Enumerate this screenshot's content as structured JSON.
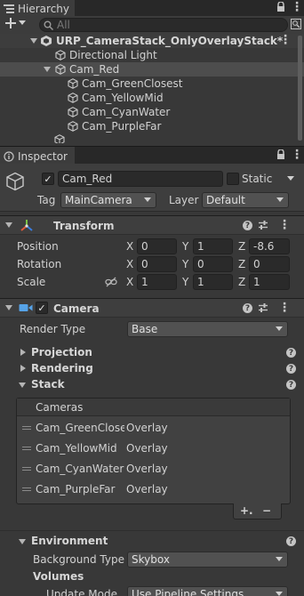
{
  "hierarchy": {
    "tab_label": "Hierarchy",
    "search_placeholder": "All",
    "scene_name": "URP_CameraStack_OnlyOverlayStack*",
    "items": [
      {
        "label": "Directional Light"
      },
      {
        "label": "Cam_Red"
      },
      {
        "label": "Cam_GreenClosest"
      },
      {
        "label": "Cam_YellowMid"
      },
      {
        "label": "Cam_CyanWater"
      },
      {
        "label": "Cam_PurpleFar"
      }
    ]
  },
  "inspector": {
    "tab_label": "Inspector",
    "object_name": "Cam_Red",
    "static_label": "Static",
    "tag_label": "Tag",
    "tag_value": "MainCamera",
    "layer_label": "Layer",
    "layer_value": "Default",
    "transform": {
      "title": "Transform",
      "rows": [
        {
          "label": "Position",
          "x": "0",
          "y": "1",
          "z": "-8.6"
        },
        {
          "label": "Rotation",
          "x": "0",
          "y": "0",
          "z": "0"
        },
        {
          "label": "Scale",
          "x": "1",
          "y": "1",
          "z": "1"
        }
      ],
      "axis_x": "X",
      "axis_y": "Y",
      "axis_z": "Z"
    },
    "camera": {
      "title": "Camera",
      "render_type_label": "Render Type",
      "render_type_value": "Base",
      "sections": {
        "projection": "Projection",
        "rendering": "Rendering",
        "stack": "Stack",
        "environment": "Environment"
      },
      "stack_list": {
        "header": "Cameras",
        "items": [
          {
            "name": "Cam_GreenClosest",
            "type": "Overlay"
          },
          {
            "name": "Cam_YellowMid",
            "type": "Overlay"
          },
          {
            "name": "Cam_CyanWater",
            "type": "Overlay"
          },
          {
            "name": "Cam_PurpleFar",
            "type": "Overlay"
          }
        ],
        "add_label": "+.",
        "remove_label": "−"
      },
      "environment": {
        "background_type_label": "Background Type",
        "background_type_value": "Skybox",
        "volumes_label": "Volumes",
        "update_mode_label": "Update Mode",
        "update_mode_value": "Use Pipeline Settings"
      }
    }
  },
  "colors": {
    "panel_bg": "#383838",
    "header_bg": "#3e3e3e",
    "tabbar_bg": "#282828",
    "field_bg": "#2a2a2a",
    "selected_row": "#4d4d4d",
    "transform_x": "#e05a3a",
    "transform_y": "#7bc143",
    "transform_z": "#3a7de0",
    "camera_icon": "#56a3e8"
  },
  "icons": [
    "plus-icon",
    "search-icon",
    "lock-icon",
    "menu-icon",
    "unity-scene-icon",
    "gameobject-cube-icon",
    "transform-icon",
    "camera-icon",
    "help-icon",
    "preset-icon",
    "kebab-icon",
    "link-icon"
  ]
}
